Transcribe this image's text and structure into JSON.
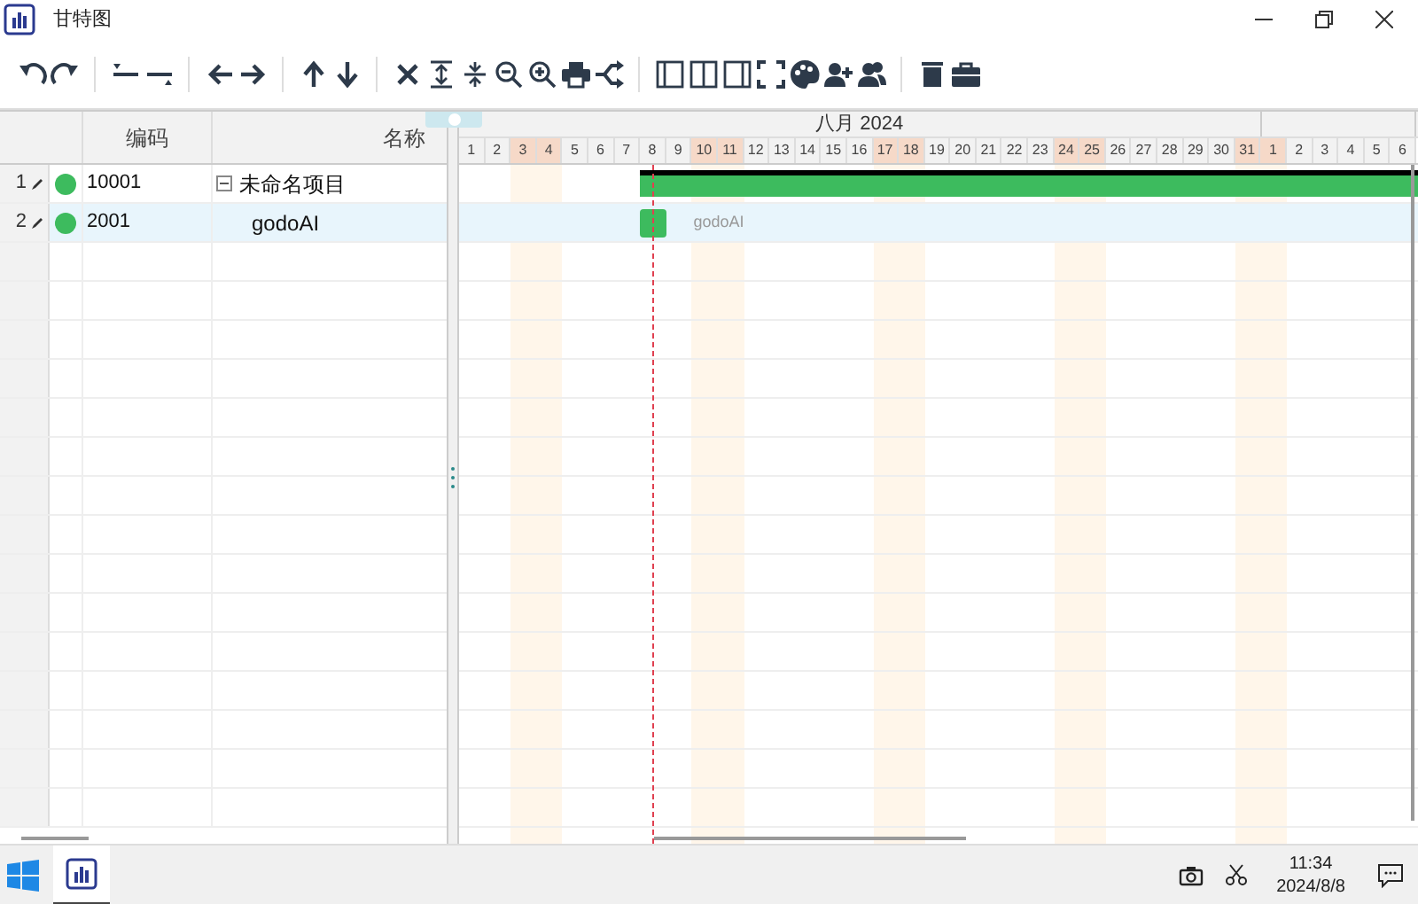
{
  "window": {
    "title": "甘特图"
  },
  "grid": {
    "columns": [
      "编码",
      "名称"
    ],
    "rows": [
      {
        "number": "1",
        "code": "10001",
        "name": "未命名项目",
        "color": "#3dbb5e",
        "expanded": true,
        "selected": false,
        "kind": "summary",
        "children": [
          {
            "number": "2",
            "code": "2001",
            "name": "godoAI",
            "color": "#3dbb5e",
            "selected": true,
            "kind": "task",
            "bar_label": "godoAI"
          }
        ]
      }
    ]
  },
  "timeline": {
    "months": [
      {
        "label": "八月 2024",
        "days": [
          {
            "label": "1",
            "weekend": false
          },
          {
            "label": "2",
            "weekend": false
          },
          {
            "label": "3",
            "weekend": true
          },
          {
            "label": "4",
            "weekend": true
          },
          {
            "label": "5",
            "weekend": false
          },
          {
            "label": "6",
            "weekend": false
          },
          {
            "label": "7",
            "weekend": false
          },
          {
            "label": "8",
            "weekend": false,
            "today": true
          },
          {
            "label": "9",
            "weekend": false
          },
          {
            "label": "10",
            "weekend": true
          },
          {
            "label": "11",
            "weekend": true
          },
          {
            "label": "12",
            "weekend": false
          },
          {
            "label": "13",
            "weekend": false
          },
          {
            "label": "14",
            "weekend": false
          },
          {
            "label": "15",
            "weekend": false
          },
          {
            "label": "16",
            "weekend": false
          },
          {
            "label": "17",
            "weekend": true
          },
          {
            "label": "18",
            "weekend": true
          },
          {
            "label": "19",
            "weekend": false
          },
          {
            "label": "20",
            "weekend": false
          },
          {
            "label": "21",
            "weekend": false
          },
          {
            "label": "22",
            "weekend": false
          },
          {
            "label": "23",
            "weekend": false
          },
          {
            "label": "24",
            "weekend": true
          },
          {
            "label": "25",
            "weekend": true
          },
          {
            "label": "26",
            "weekend": false
          },
          {
            "label": "27",
            "weekend": false
          },
          {
            "label": "28",
            "weekend": false
          },
          {
            "label": "29",
            "weekend": false
          },
          {
            "label": "30",
            "weekend": false
          },
          {
            "label": "31",
            "weekend": true
          }
        ]
      },
      {
        "days": [
          {
            "label": "1",
            "weekend": true
          },
          {
            "label": "2",
            "weekend": false
          },
          {
            "label": "3",
            "weekend": false
          },
          {
            "label": "4",
            "weekend": false
          },
          {
            "label": "5",
            "weekend": false
          },
          {
            "label": "6",
            "weekend": false
          }
        ]
      }
    ]
  },
  "taskbar": {
    "time": "11:34",
    "date": "2024/8/8"
  }
}
